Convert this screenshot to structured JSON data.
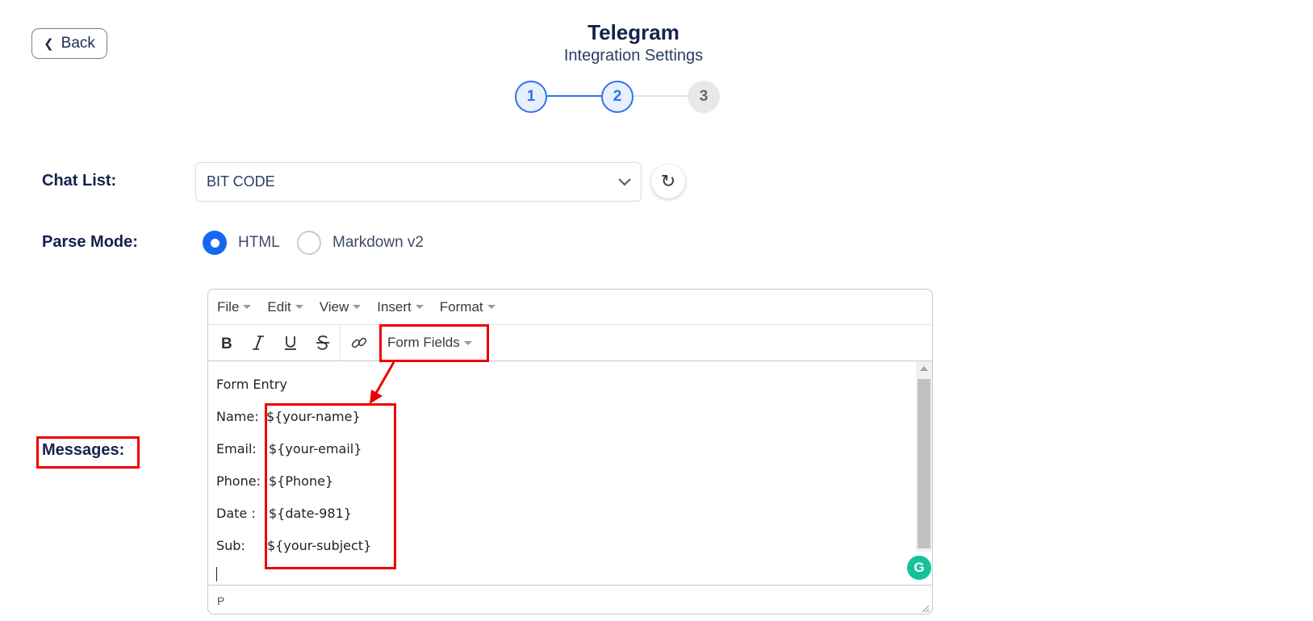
{
  "header": {
    "back_label": "Back",
    "title": "Telegram",
    "subtitle": "Integration Settings"
  },
  "stepper": {
    "steps": [
      "1",
      "2",
      "3"
    ],
    "current_step": 2
  },
  "chat_list": {
    "label": "Chat List:",
    "selected": "BIT CODE"
  },
  "parse_mode": {
    "label": "Parse Mode:",
    "options": [
      "HTML",
      "Markdown v2"
    ],
    "selected": "HTML"
  },
  "messages": {
    "label": "Messages:"
  },
  "editor": {
    "menu": [
      "File",
      "Edit",
      "View",
      "Insert",
      "Format"
    ],
    "form_fields_label": "Form Fields",
    "content": {
      "heading": "Form Entry",
      "rows": [
        {
          "label": "Name:",
          "value": "${your-name}"
        },
        {
          "label": "Email:",
          "value": "${your-email}"
        },
        {
          "label": "Phone:",
          "value": "${Phone}"
        },
        {
          "label": "Date :",
          "value": "${date-981}"
        },
        {
          "label": "Sub:",
          "value": "${your-subject}"
        }
      ]
    },
    "status_path": "P"
  },
  "colors": {
    "primary": "#1467f0",
    "title": "#14224d",
    "annotation_red": "#ee0000",
    "grammarly": "#15c39a"
  },
  "icons": [
    "chevron-left-icon",
    "chevron-down-icon",
    "refresh-icon",
    "bold-icon",
    "italic-icon",
    "underline-icon",
    "strikethrough-icon",
    "link-icon",
    "grammarly-icon",
    "resize-handle-icon"
  ]
}
